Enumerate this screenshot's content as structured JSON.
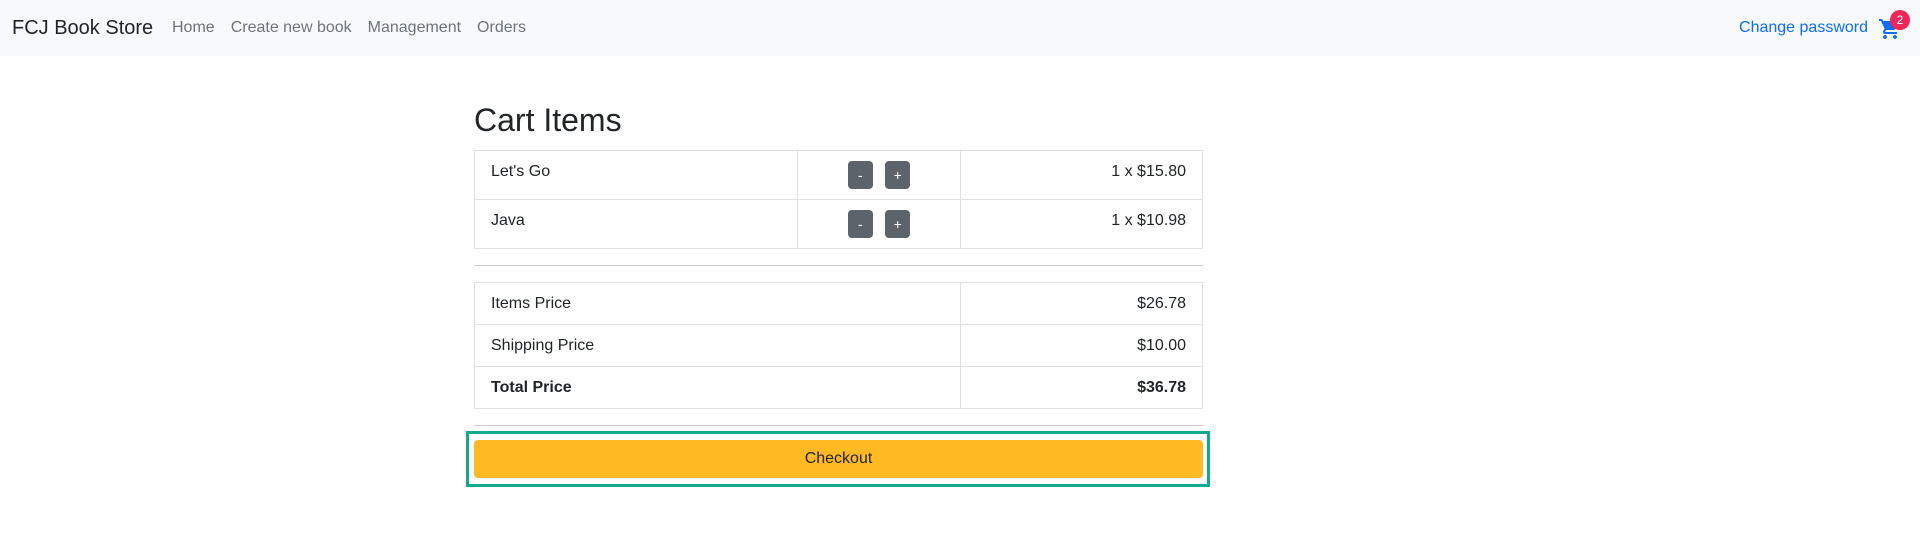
{
  "navbar": {
    "brand": "FCJ Book Store",
    "links": [
      "Home",
      "Create new book",
      "Management",
      "Orders"
    ],
    "change_password": "Change password",
    "cart_icon": "shopping-cart-icon",
    "cart_count": "2",
    "badge_color": "#f0265a",
    "link_color": "#0d6efd"
  },
  "main": {
    "title": "Cart Items",
    "cart_items": [
      {
        "name": "Let's Go",
        "minus_label": "-",
        "plus_label": "+",
        "price": "1 x $15.80"
      },
      {
        "name": "Java",
        "minus_label": "-",
        "plus_label": "+",
        "price": "1 x $10.98"
      }
    ],
    "summary": [
      {
        "label": "Items Price",
        "value": "$26.78"
      },
      {
        "label": "Shipping Price",
        "value": "$10.00"
      },
      {
        "label": "Total Price",
        "value": "$36.78"
      }
    ],
    "checkout_label": "Checkout",
    "checkout_color": "#ffb923",
    "highlight_color": "#14a88c"
  }
}
